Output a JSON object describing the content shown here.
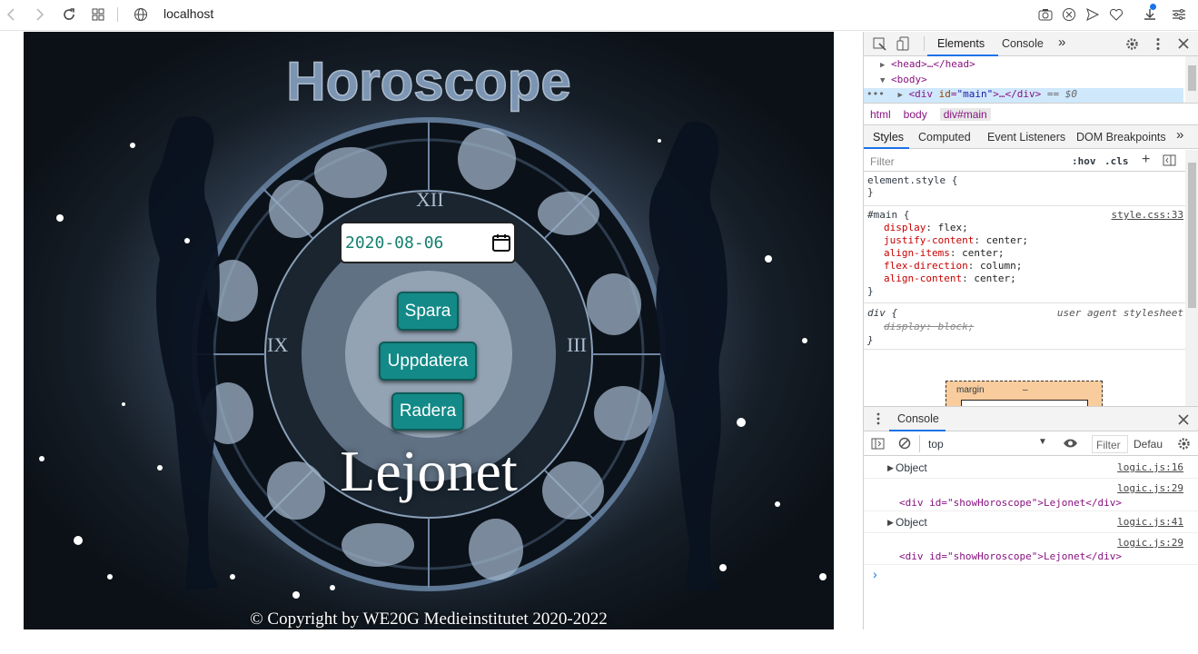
{
  "browser": {
    "url": "localhost"
  },
  "page": {
    "logo_text": "Horoscope",
    "date_value": "2020-08-06",
    "buttons": {
      "save": "Spara",
      "update": "Uppdatera",
      "delete": "Radera"
    },
    "sign_name": "Lejonet",
    "copyright": "© Copyright by WE20G Medieinstitutet 2020-2022",
    "colors": {
      "button_bg": "#138a87",
      "date_text": "#15806f"
    }
  },
  "devtools": {
    "tabs": [
      "Elements",
      "Console"
    ],
    "more": "»",
    "dom": {
      "head": "<head>…</head>",
      "body": "<body>",
      "selected_tag": "div",
      "selected_attr": "id",
      "selected_val": "\"main\"",
      "selected_rest": ">…</div>",
      "selected_suffix": "== $0",
      "ellipsis": "•••"
    },
    "breadcrumbs": [
      "html",
      "body",
      "div#main"
    ],
    "style_tabs": [
      "Styles",
      "Computed",
      "Event Listeners",
      "DOM Breakpoints"
    ],
    "filter_placeholder": "Filter",
    "hov": ":hov",
    "cls": ".cls",
    "rules": {
      "element_style": "element.style {",
      "close": "}",
      "main_selector": "#main {",
      "main_source": "style.css:33",
      "main_props": [
        {
          "name": "display",
          "value": "flex;"
        },
        {
          "name": "justify-content",
          "value": "center;"
        },
        {
          "name": "align-items",
          "value": "center;"
        },
        {
          "name": "flex-direction",
          "value": "column;"
        },
        {
          "name": "align-content",
          "value": "center;"
        }
      ],
      "div_selector": "div {",
      "div_source": "user agent stylesheet",
      "div_prop": "display: block;"
    },
    "box_model": {
      "label": "margin",
      "value": "–"
    },
    "console": {
      "title": "Console",
      "context": "top",
      "filter": "Filter",
      "level": "Defau",
      "entries": [
        {
          "text": "Object",
          "source": "logic.js:16"
        },
        {
          "text": "<div id=\"showHoroscope\">Lejonet</div>",
          "source": "logic.js:29"
        },
        {
          "text": "Object",
          "source": "logic.js:41"
        },
        {
          "text": "<div id=\"showHoroscope\">Lejonet</div>",
          "source": "logic.js:29"
        }
      ],
      "prompt": "›"
    }
  }
}
